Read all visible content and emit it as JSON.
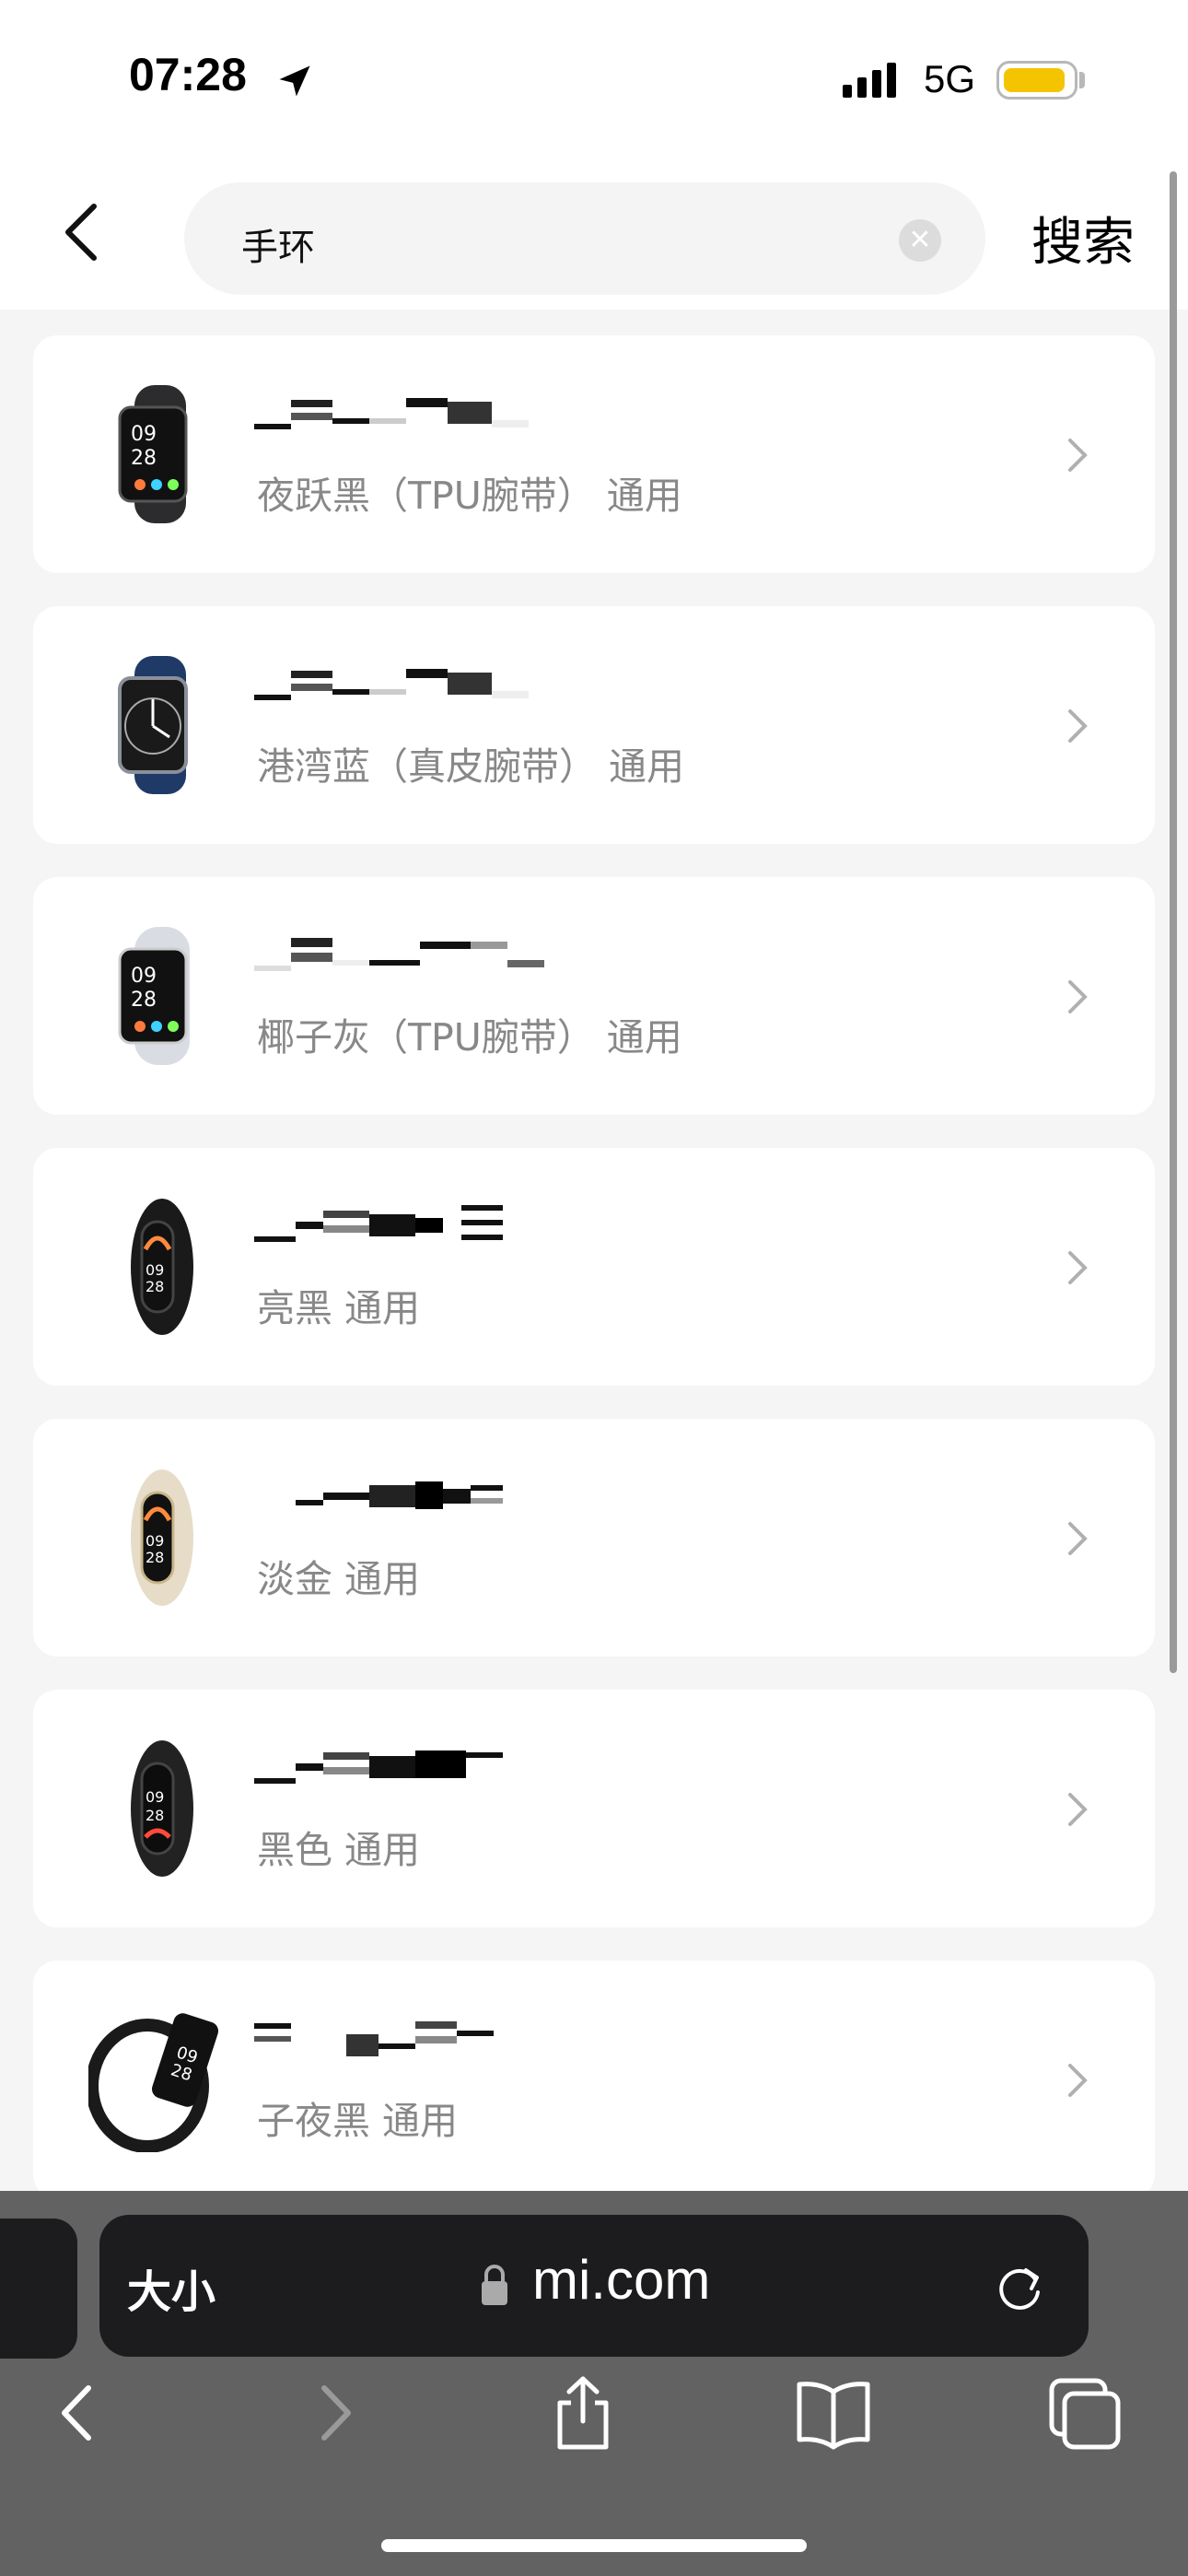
{
  "status_bar": {
    "time": "07:28",
    "network": "5G",
    "battery_color": "#f5c400"
  },
  "header": {
    "search_query": "手环",
    "search_button": "搜索"
  },
  "results": [
    {
      "subtitle": "夜跃黑（TPU腕带） 通用",
      "image": "watch-black-band",
      "band_color": "#2c2c2e"
    },
    {
      "subtitle": "港湾蓝（真皮腕带） 通用",
      "image": "watch-blue-leather",
      "band_color": "#1f3a66"
    },
    {
      "subtitle": "椰子灰（TPU腕带） 通用",
      "image": "watch-white-band",
      "band_color": "#d9dde3"
    },
    {
      "subtitle": "亮黑 通用",
      "image": "band-black",
      "band_color": "#1a1a1a"
    },
    {
      "subtitle": "淡金 通用",
      "image": "band-gold",
      "band_color": "#e6dcc8"
    },
    {
      "subtitle": "黑色 通用",
      "image": "band-black",
      "band_color": "#222222"
    },
    {
      "subtitle": "子夜黑 通用",
      "image": "band-black-rect",
      "band_color": "#1a1a1a"
    }
  ],
  "browser": {
    "text_size_label": "大小",
    "url": "mi.com"
  }
}
